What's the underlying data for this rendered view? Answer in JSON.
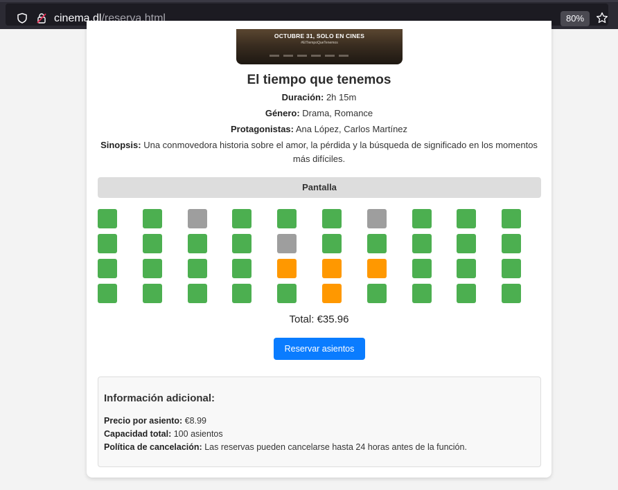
{
  "browser": {
    "url_host": "cinema.dl",
    "url_path": "/reserva.html",
    "zoom": "80%"
  },
  "poster": {
    "headline": "OCTUBRE 31, SOLO EN CINES",
    "tag": "#ElTiempoQueTenemos"
  },
  "movie": {
    "title": "El tiempo que tenemos",
    "duration_label": "Duración:",
    "duration": "2h 15m",
    "genre_label": "Género:",
    "genre": "Drama, Romance",
    "cast_label": "Protagonistas:",
    "cast": "Ana López, Carlos Martínez",
    "synopsis_label": "Sinopsis:",
    "synopsis": "Una conmovedora historia sobre el amor, la pérdida y la búsqueda de significado en los momentos más difíciles."
  },
  "screen_label": "Pantalla",
  "seats": [
    [
      "available",
      "available",
      "occupied",
      "available",
      "available",
      "available",
      "occupied",
      "available",
      "available",
      "available"
    ],
    [
      "available",
      "available",
      "available",
      "available",
      "occupied",
      "available",
      "available",
      "available",
      "available",
      "available"
    ],
    [
      "available",
      "available",
      "available",
      "available",
      "selected",
      "selected",
      "selected",
      "available",
      "available",
      "available"
    ],
    [
      "available",
      "available",
      "available",
      "available",
      "available",
      "selected",
      "available",
      "available",
      "available",
      "available"
    ]
  ],
  "colors": {
    "available": "#4caf50",
    "occupied": "#9e9e9e",
    "selected": "#ff9800",
    "button": "#0a7cff"
  },
  "total_text": "Total: €35.96",
  "reserve_button": "Reservar asientos",
  "additional": {
    "heading": "Información adicional:",
    "price_label": "Precio por asiento:",
    "price": "€8.99",
    "capacity_label": "Capacidad total:",
    "capacity": "100 asientos",
    "policy_label": "Política de cancelación:",
    "policy": "Las reservas pueden cancelarse hasta 24 horas antes de la función."
  }
}
